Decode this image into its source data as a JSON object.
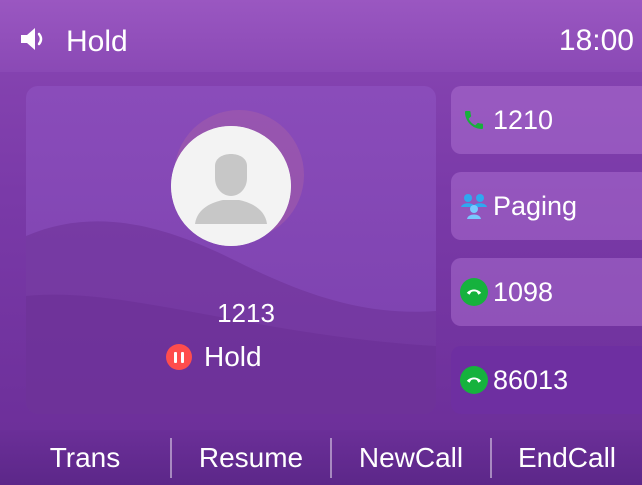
{
  "status_bar": {
    "title": "Hold",
    "time": "18:00",
    "icons": [
      "speaker-icon"
    ]
  },
  "call": {
    "number": "1213",
    "status": "Hold",
    "status_icon": "pause-badge-icon",
    "avatar_icon": "contact-avatar-icon"
  },
  "lines": [
    {
      "label": "1210",
      "icon": "phone-handset-icon"
    },
    {
      "label": "Paging",
      "icon": "paging-group-icon"
    },
    {
      "label": "1098",
      "icon": "green-handset-icon"
    },
    {
      "label": "86013",
      "icon": "green-handset-icon"
    }
  ],
  "softkeys": [
    {
      "label": "Trans"
    },
    {
      "label": "Resume"
    },
    {
      "label": "NewCall"
    },
    {
      "label": "EndCall"
    }
  ],
  "colors": {
    "background": "#7a3aa8",
    "hold_badge": "#ff4d4d",
    "green": "#16b23d",
    "paging_icon": "#2fa8f0"
  }
}
